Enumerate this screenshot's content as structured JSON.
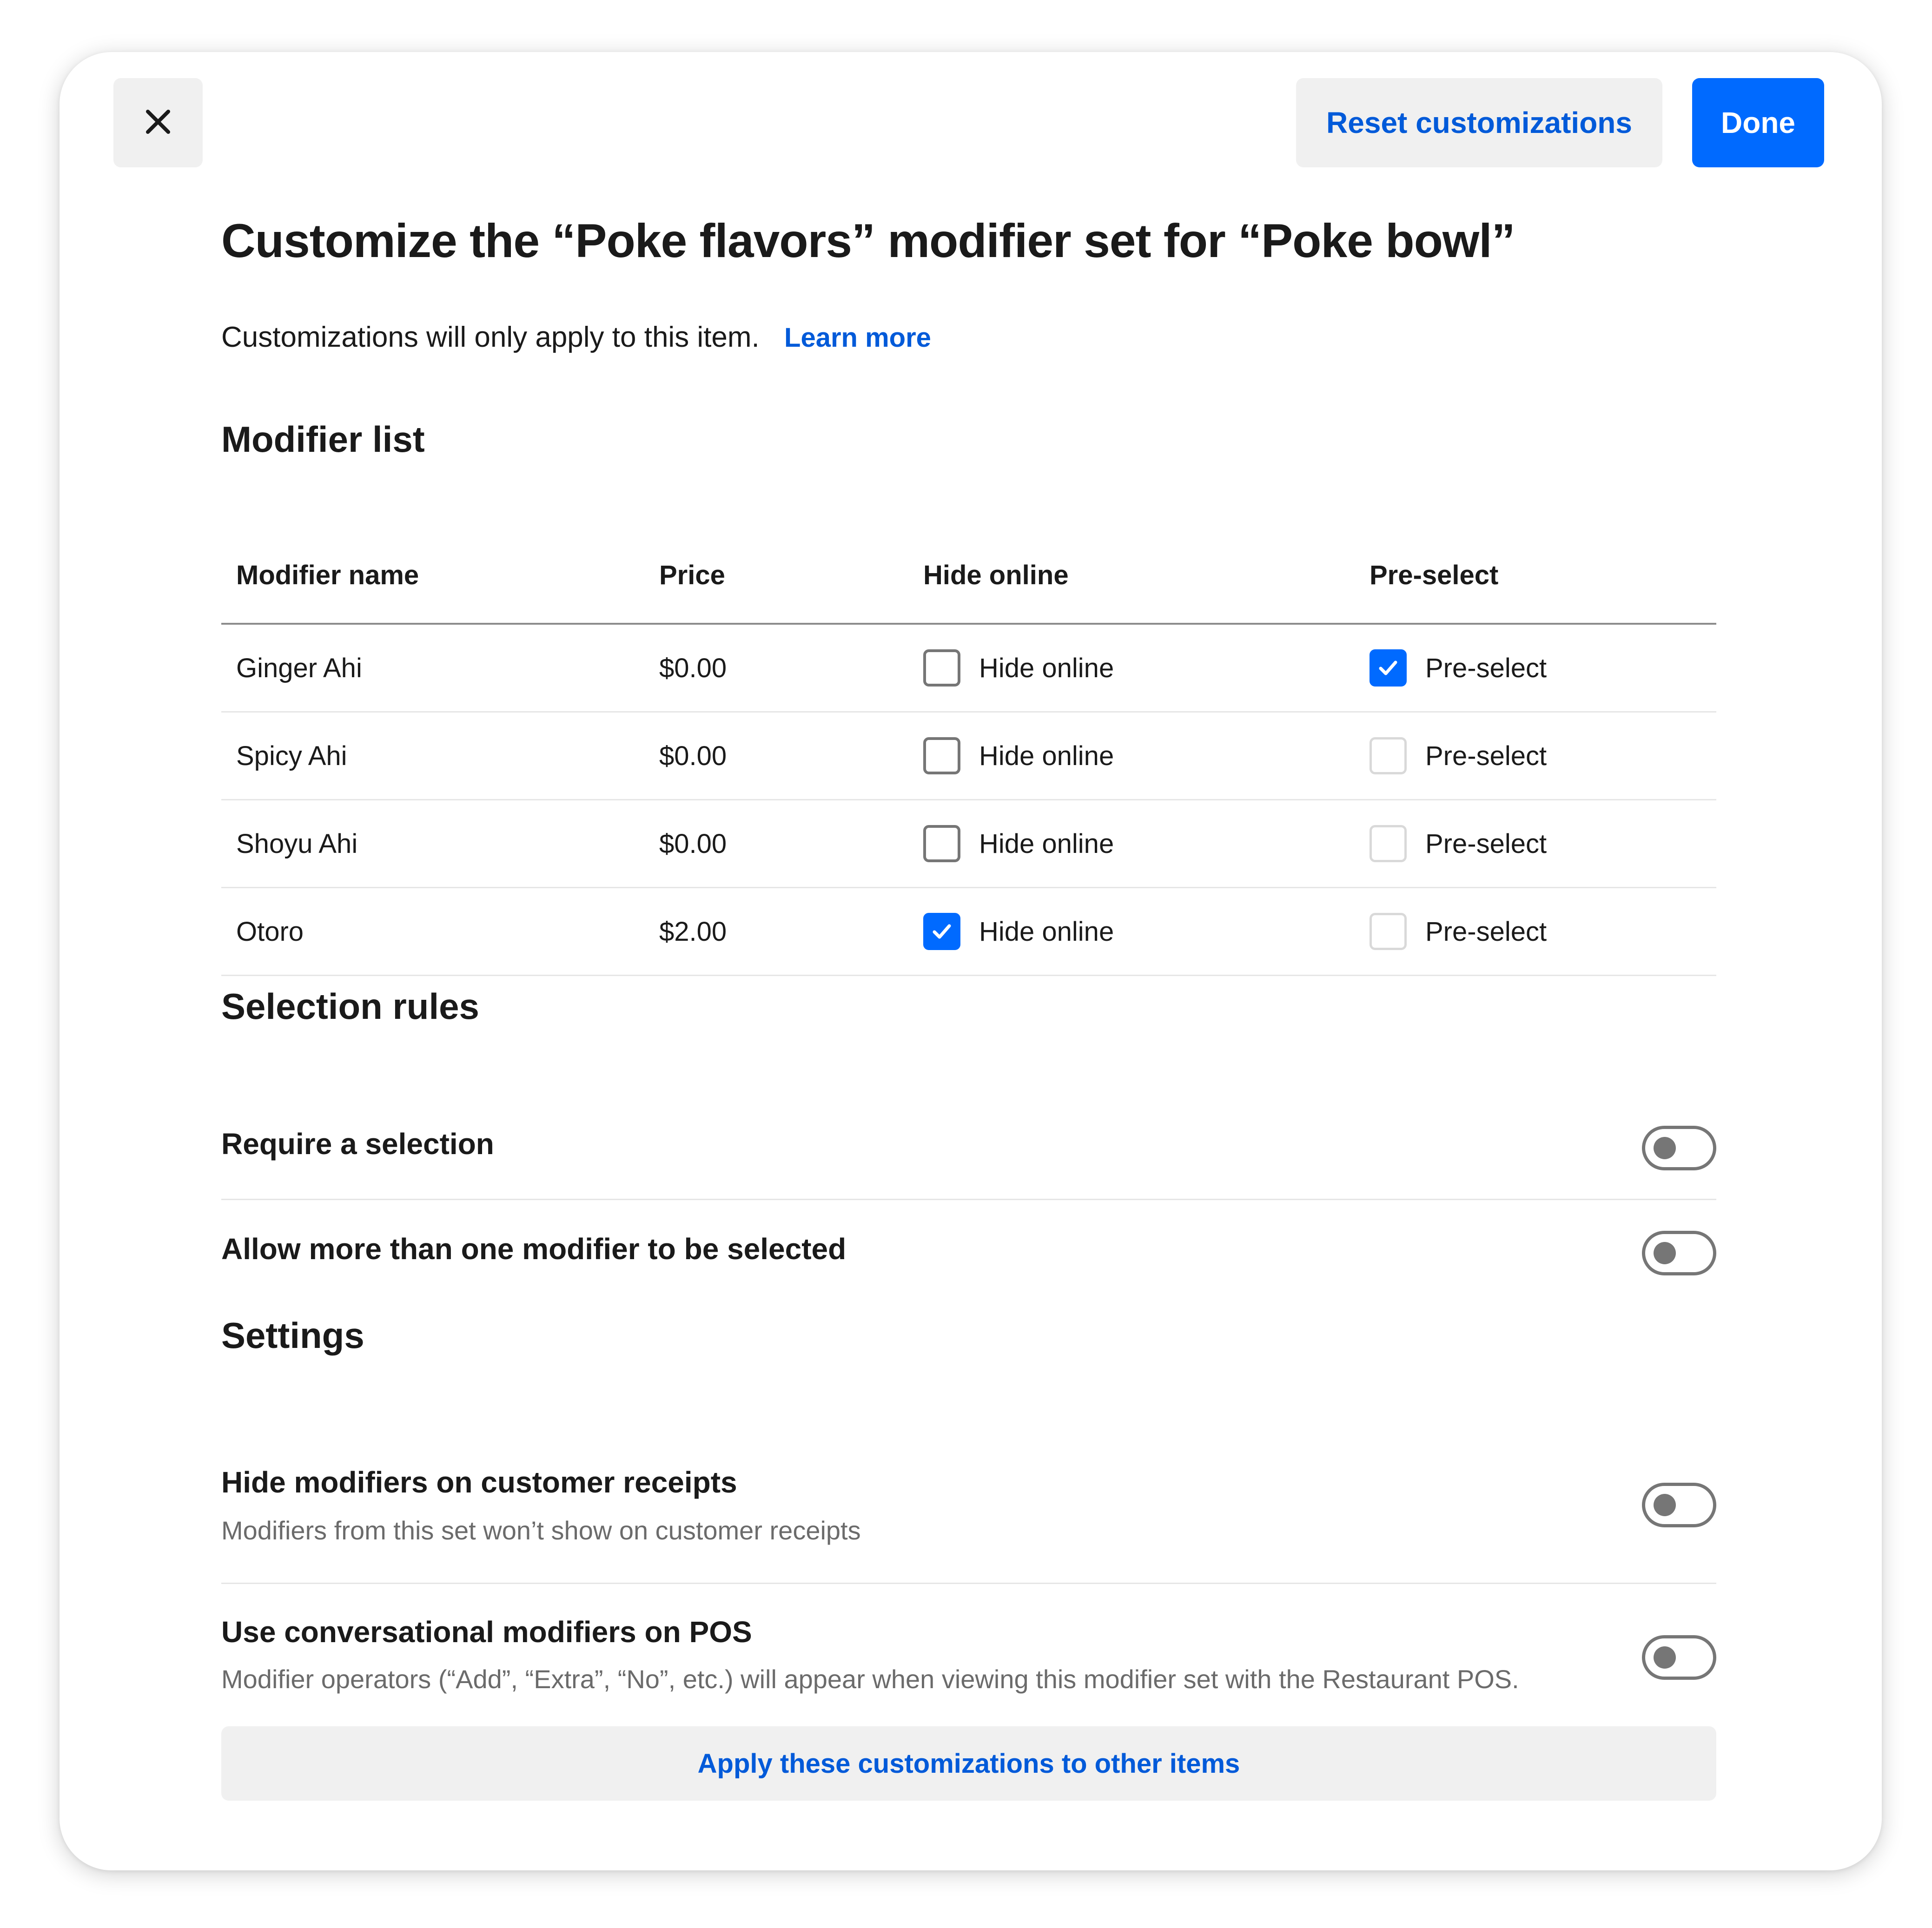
{
  "toolbar": {
    "close_icon": "close-icon",
    "reset_label": "Reset customizations",
    "done_label": "Done"
  },
  "header": {
    "title": "Customize the “Poke flavors” modifier set for “Poke bowl”",
    "subtitle": "Customizations will only apply to this item.",
    "learn_more": "Learn more"
  },
  "modifier_list": {
    "heading": "Modifier list",
    "columns": [
      "Modifier name",
      "Price",
      "Hide online",
      "Pre-select"
    ],
    "rows": [
      {
        "name": "Ginger Ahi",
        "price": "$0.00",
        "hide_label": "Hide online",
        "hide_checked": false,
        "pre_label": "Pre-select",
        "pre_checked": true
      },
      {
        "name": "Spicy Ahi",
        "price": "$0.00",
        "hide_label": "Hide online",
        "hide_checked": false,
        "pre_label": "Pre-select",
        "pre_checked": false
      },
      {
        "name": "Shoyu Ahi",
        "price": "$0.00",
        "hide_label": "Hide online",
        "hide_checked": false,
        "pre_label": "Pre-select",
        "pre_checked": false
      },
      {
        "name": "Otoro",
        "price": "$2.00",
        "hide_label": "Hide online",
        "hide_checked": true,
        "pre_label": "Pre-select",
        "pre_checked": false
      }
    ]
  },
  "selection_rules": {
    "heading": "Selection rules",
    "items": [
      {
        "label": "Require a selection",
        "on": false
      },
      {
        "label": "Allow more than one modifier to be selected",
        "on": false
      }
    ]
  },
  "settings": {
    "heading": "Settings",
    "items": [
      {
        "label": "Hide modifiers on customer receipts",
        "description": "Modifiers from this set won’t show on customer receipts",
        "on": false
      },
      {
        "label": "Use conversational modifiers on POS",
        "description": "Modifier operators (“Add”, “Extra”, “No”, etc.) will appear when viewing this modifier set with the Restaurant POS.",
        "on": false
      }
    ]
  },
  "footer": {
    "apply_label": "Apply these customizations to other items"
  },
  "colors": {
    "accent": "#006aff",
    "link": "#005ad9",
    "button_bg": "#f0f0f0"
  }
}
